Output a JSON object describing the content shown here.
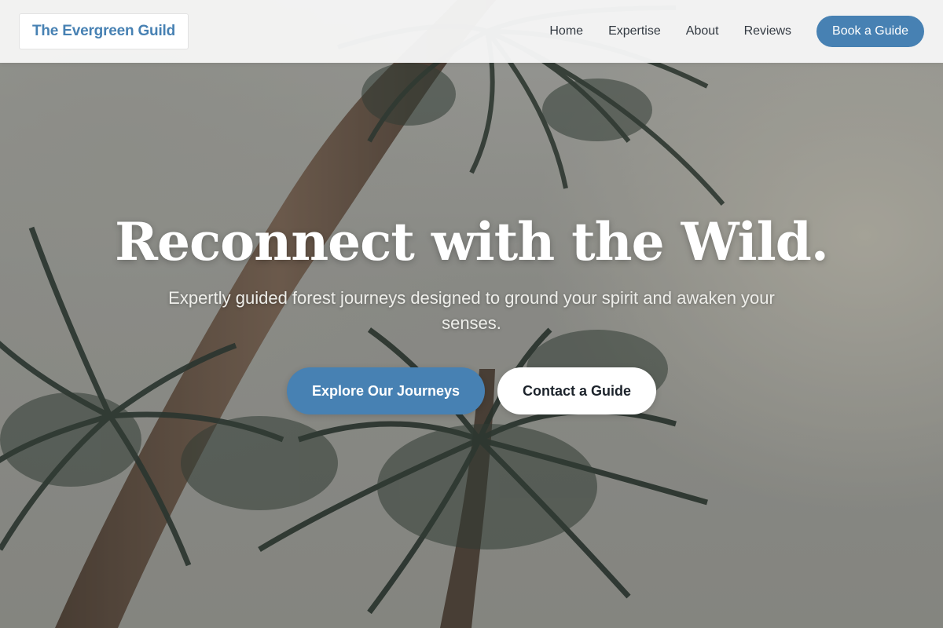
{
  "header": {
    "logo_text": "The Evergreen Guild",
    "nav": [
      {
        "label": "Home"
      },
      {
        "label": "Expertise"
      },
      {
        "label": "About"
      },
      {
        "label": "Reviews"
      }
    ],
    "cta_label": "Book a Guide"
  },
  "hero": {
    "title": "Reconnect with the Wild.",
    "subtitle": "Expertly guided forest journeys designed to ground your spirit and awaken your senses.",
    "primary_button": "Explore Our Journeys",
    "secondary_button": "Contact a Guide"
  },
  "colors": {
    "brand": "#4781b3",
    "header_bg": "#f5f5f5",
    "nav_text": "#333a42"
  }
}
